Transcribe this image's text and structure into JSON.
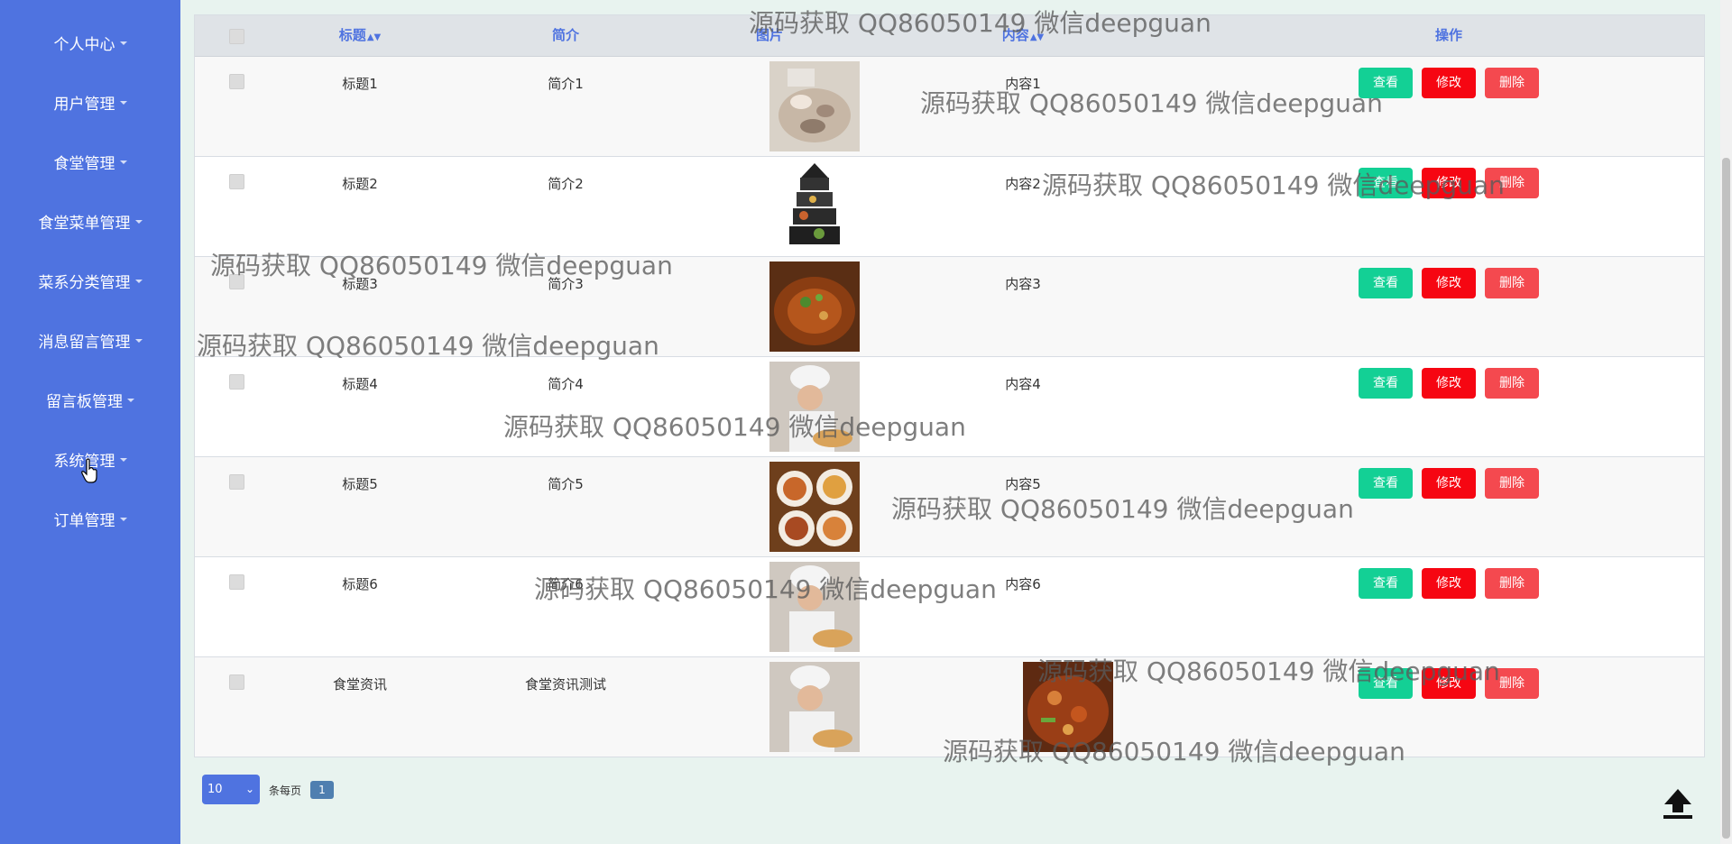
{
  "sidebar": {
    "items": [
      {
        "label": "个人中心"
      },
      {
        "label": "用户管理"
      },
      {
        "label": "食堂管理"
      },
      {
        "label": "食堂菜单管理"
      },
      {
        "label": "菜系分类管理"
      },
      {
        "label": "消息留言管理"
      },
      {
        "label": "留言板管理"
      },
      {
        "label": "系统管理"
      },
      {
        "label": "订单管理"
      }
    ]
  },
  "table": {
    "headers": {
      "title": "标题",
      "intro": "简介",
      "image": "图片",
      "content": "内容",
      "actions": "操作"
    },
    "buttons": {
      "view": "查看",
      "edit": "修改",
      "delete": "删除"
    },
    "rows": [
      {
        "title": "标题1",
        "intro": "简介1",
        "content": "内容1"
      },
      {
        "title": "标题2",
        "intro": "简介2",
        "content": "内容2"
      },
      {
        "title": "标题3",
        "intro": "简介3",
        "content": "内容3"
      },
      {
        "title": "标题4",
        "intro": "简介4",
        "content": "内容4"
      },
      {
        "title": "标题5",
        "intro": "简介5",
        "content": "内容5"
      },
      {
        "title": "标题6",
        "intro": "简介6",
        "content": "内容6"
      },
      {
        "title": "食堂资讯",
        "intro": "食堂资讯测试",
        "content": ""
      }
    ]
  },
  "pagination": {
    "page_size": "10",
    "per_page_label": "条每页",
    "current_page": "1"
  },
  "watermark": "源码获取 QQ86050149 微信deepguan",
  "colors": {
    "sidebar": "#4f73e0",
    "view_button": "#13d095",
    "edit_button": "#f60612",
    "delete_button": "#f4494f"
  }
}
